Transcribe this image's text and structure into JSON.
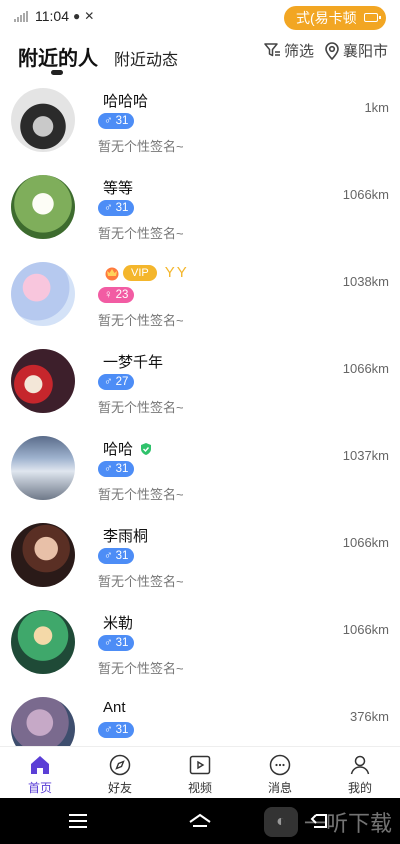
{
  "status": {
    "time": "11:04",
    "carrier_pill": "式(易卡顿"
  },
  "header": {
    "tab_active": "附近的人",
    "tab_other": "附近动态",
    "filter_label": "筛选",
    "city": "襄阳市"
  },
  "users": [
    {
      "name": "哈哈哈",
      "gender": "♂",
      "age": "31",
      "signature": "暂无个性签名~",
      "distance": "1km"
    },
    {
      "name": "等等",
      "gender": "♂",
      "age": "31",
      "signature": "暂无个性签名~",
      "distance": "1066km"
    },
    {
      "name": "",
      "gender": "♀",
      "age": "23",
      "signature": "暂无个性签名~",
      "distance": "1038km",
      "vip_label": "VIP",
      "vip_extra": "YY"
    },
    {
      "name": "一梦千年",
      "gender": "♂",
      "age": "27",
      "signature": "暂无个性签名~",
      "distance": "1066km"
    },
    {
      "name": "哈哈",
      "gender": "♂",
      "age": "31",
      "signature": "暂无个性签名~",
      "distance": "1037km"
    },
    {
      "name": "李雨桐",
      "gender": "♂",
      "age": "31",
      "signature": "暂无个性签名~",
      "distance": "1066km"
    },
    {
      "name": "米勒",
      "gender": "♂",
      "age": "31",
      "signature": "暂无个性签名~",
      "distance": "1066km"
    },
    {
      "name": "Ant",
      "gender": "♂",
      "age": "31",
      "signature": "",
      "distance": "376km"
    }
  ],
  "tabbar": [
    {
      "label": "首页",
      "icon": "home-icon"
    },
    {
      "label": "好友",
      "icon": "compass-icon"
    },
    {
      "label": "视频",
      "icon": "video-icon"
    },
    {
      "label": "消息",
      "icon": "chat-icon"
    },
    {
      "label": "我的",
      "icon": "person-icon"
    }
  ],
  "watermark": "一听下载",
  "colors": {
    "accent": "#5b3fd6",
    "male": "#4d8df6",
    "female": "#f25ca3",
    "pill": "#f2a623",
    "vip": "#f4b62c"
  }
}
